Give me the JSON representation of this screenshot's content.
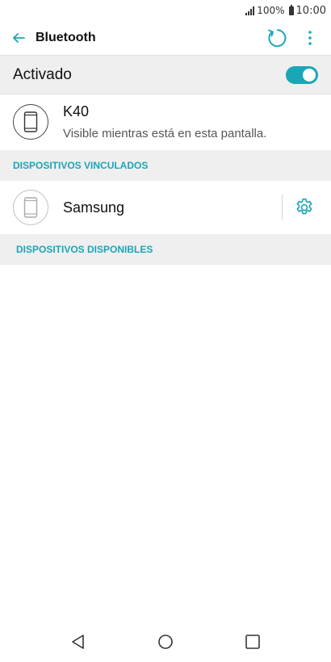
{
  "status_bar": {
    "battery": "100%",
    "time": "10:00"
  },
  "app_bar": {
    "title": "Bluetooth",
    "back_icon": "arrow-left-icon",
    "refresh_icon": "refresh-icon",
    "more_icon": "more-vert-icon"
  },
  "toggle": {
    "label": "Activado",
    "state": true
  },
  "this_device": {
    "name": "K40",
    "subtitle": "Visible mientras está en esta pantalla."
  },
  "sections": {
    "paired_header": "DISPOSITIVOS VINCULADOS",
    "available_header": "DISPOSITIVOS DISPONIBLES"
  },
  "paired_devices": [
    {
      "name": "Samsung"
    }
  ],
  "colors": {
    "accent": "#1aa6b7",
    "section_bg": "#efefef",
    "text": "#111111"
  }
}
